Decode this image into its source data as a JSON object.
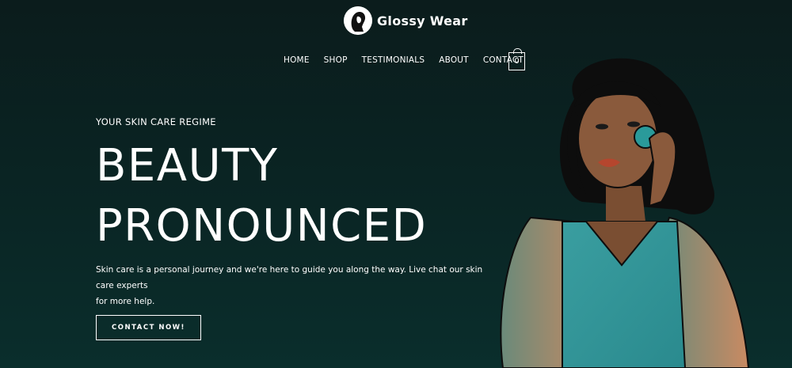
{
  "brand": {
    "name": "Glossy Wear"
  },
  "nav": {
    "items": [
      {
        "label": "HOME"
      },
      {
        "label": "SHOP"
      },
      {
        "label": "TESTIMONIALS"
      },
      {
        "label": "ABOUT"
      },
      {
        "label": "CONTACT"
      }
    ],
    "cart_count": "0"
  },
  "hero": {
    "eyebrow": "YOUR SKIN CARE REGIME",
    "headline_line1": "BEAUTY",
    "headline_line2": "PRONOUNCED",
    "lede_line1": "Skin care is a personal journey and we're here to guide you along the way. Live chat our skin care experts",
    "lede_line2": "for more help.",
    "cta_label": "CONTACT NOW!"
  },
  "colors": {
    "background_top": "#0b1c1c",
    "background_bottom": "#0a2e2c",
    "dress": "#2a9a9a",
    "skin": "#8a5a3c",
    "hair": "#0d0d0d"
  },
  "icons": {
    "logo": "woman-silhouette-icon",
    "cart": "shopping-bag-icon"
  }
}
